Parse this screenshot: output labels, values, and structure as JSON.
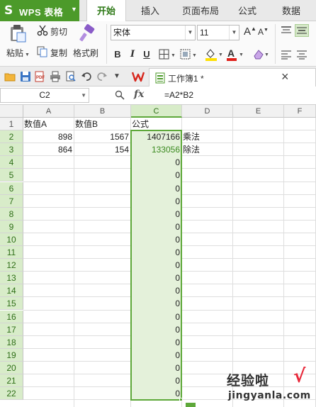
{
  "app": {
    "name": "WPS 表格",
    "logo_letter": "S"
  },
  "menu": {
    "tabs": [
      "开始",
      "插入",
      "页面布局",
      "公式",
      "数据"
    ],
    "active_index": 0
  },
  "ribbon": {
    "paste_label": "粘贴",
    "cut_label": "剪切",
    "copy_label": "复制",
    "format_painter_label": "格式刷",
    "font_name": "宋体",
    "font_size": "11",
    "grow_font": "A",
    "shrink_font": "A",
    "bold": "B",
    "italic": "I",
    "underline": "U",
    "font_color_letter": "A",
    "colors": {
      "fill": "#ffe000",
      "font": "#e0201a"
    }
  },
  "document": {
    "tab_label": "工作簿1 *",
    "close": "×"
  },
  "formula_bar": {
    "cell_ref": "C2",
    "fx": "fx",
    "formula": "=A2*B2"
  },
  "sheet": {
    "columns": [
      "A",
      "B",
      "C",
      "D",
      "E",
      "F"
    ],
    "selected_column": "C",
    "rows": [
      {
        "n": "1",
        "A": "数值A",
        "B": "数值B",
        "C": "公式",
        "D": ""
      },
      {
        "n": "2",
        "A": "898",
        "B": "1567",
        "C": "1407166",
        "D": "乘法"
      },
      {
        "n": "3",
        "A": "864",
        "B": "154",
        "C": "133056",
        "D": "除法"
      },
      {
        "n": "4",
        "A": "",
        "B": "",
        "C": "0",
        "D": ""
      },
      {
        "n": "5",
        "A": "",
        "B": "",
        "C": "0",
        "D": ""
      },
      {
        "n": "6",
        "A": "",
        "B": "",
        "C": "0",
        "D": ""
      },
      {
        "n": "7",
        "A": "",
        "B": "",
        "C": "0",
        "D": ""
      },
      {
        "n": "8",
        "A": "",
        "B": "",
        "C": "0",
        "D": ""
      },
      {
        "n": "9",
        "A": "",
        "B": "",
        "C": "0",
        "D": ""
      },
      {
        "n": "10",
        "A": "",
        "B": "",
        "C": "0",
        "D": ""
      },
      {
        "n": "11",
        "A": "",
        "B": "",
        "C": "0",
        "D": ""
      },
      {
        "n": "12",
        "A": "",
        "B": "",
        "C": "0",
        "D": ""
      },
      {
        "n": "13",
        "A": "",
        "B": "",
        "C": "0",
        "D": ""
      },
      {
        "n": "14",
        "A": "",
        "B": "",
        "C": "0",
        "D": ""
      },
      {
        "n": "15",
        "A": "",
        "B": "",
        "C": "0",
        "D": ""
      },
      {
        "n": "16",
        "A": "",
        "B": "",
        "C": "0",
        "D": ""
      },
      {
        "n": "17",
        "A": "",
        "B": "",
        "C": "0",
        "D": ""
      },
      {
        "n": "18",
        "A": "",
        "B": "",
        "C": "0",
        "D": ""
      },
      {
        "n": "19",
        "A": "",
        "B": "",
        "C": "0",
        "D": ""
      },
      {
        "n": "20",
        "A": "",
        "B": "",
        "C": "0",
        "D": ""
      },
      {
        "n": "21",
        "A": "",
        "B": "",
        "C": "0",
        "D": ""
      },
      {
        "n": "22",
        "A": "",
        "B": "",
        "C": "0",
        "D": ""
      }
    ]
  },
  "watermark": {
    "line1": "经验啦",
    "check": "√",
    "line2": "jingyanla.com"
  },
  "theme": {
    "accent": "#4c9a2a",
    "selection_fill": "#e4f1da",
    "selection_border": "#5ea83a"
  }
}
